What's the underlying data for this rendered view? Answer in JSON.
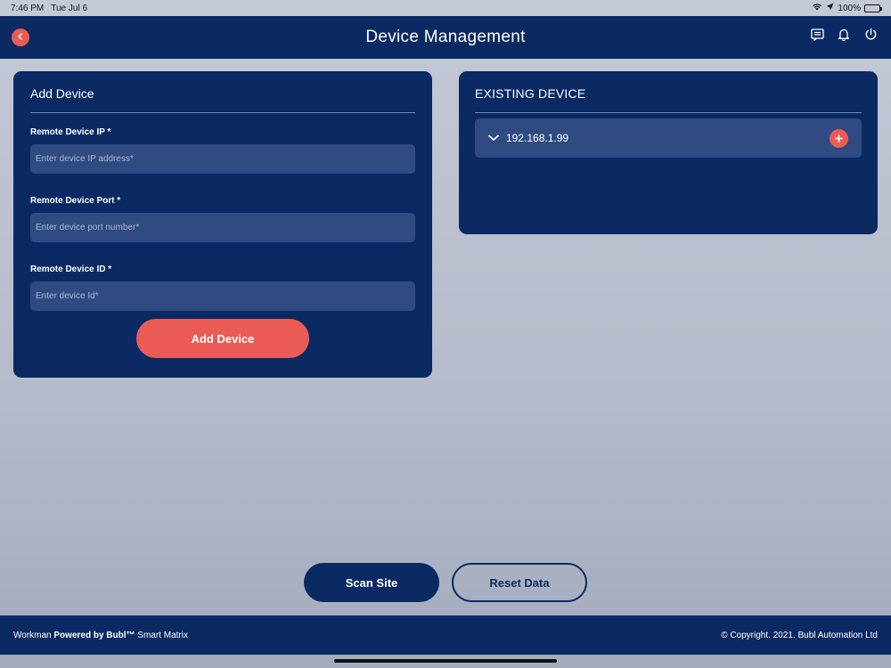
{
  "status_bar": {
    "time": "7:46 PM",
    "date": "Tue Jul 6",
    "battery": "100%"
  },
  "header": {
    "title": "Device Management",
    "icons": [
      "back-icon",
      "message-icon",
      "bell-icon",
      "power-icon"
    ]
  },
  "add_device": {
    "title": "Add Device",
    "fields": [
      {
        "label": "Remote Device IP *",
        "placeholder": "Enter device IP address*",
        "value": ""
      },
      {
        "label": "Remote Device Port *",
        "placeholder": "Enter device port number*",
        "value": ""
      },
      {
        "label": "Remote Device ID *",
        "placeholder": "Enter device Id*",
        "value": ""
      }
    ],
    "button_label": "Add Device"
  },
  "existing_device": {
    "title": "EXISTING DEVICE",
    "devices": [
      {
        "ip": "192.168.1.99"
      }
    ]
  },
  "actions": {
    "scan_label": "Scan Site",
    "reset_label": "Reset Data"
  },
  "footer": {
    "brand_prefix": "Workman ",
    "brand_bold": "Powered by Bubl™",
    "brand_suffix": " Smart Matrix",
    "copyright": "© Copyright. 2021.  Bubl Automation Ltd"
  },
  "colors": {
    "navy": "#0b2a63",
    "accent": "#ea5b55",
    "input_bg": "#2f4b82"
  }
}
